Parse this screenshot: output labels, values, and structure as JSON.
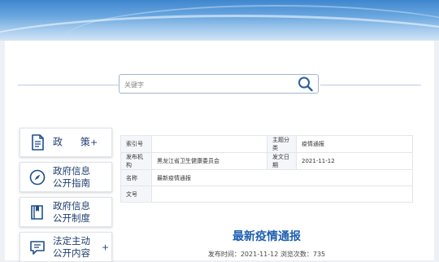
{
  "search": {
    "placeholder": "关键字"
  },
  "sidebar": {
    "items": [
      {
        "label": "政 策",
        "plus": "+"
      },
      {
        "line1": "政府信息",
        "line2": "公开指南"
      },
      {
        "line1": "政府信息",
        "line2": "公开制度"
      },
      {
        "line1": "法定主动",
        "line2": "公开内容",
        "plus": "+"
      }
    ]
  },
  "info_table": {
    "index_label": "索引号",
    "index_value": "",
    "category_label": "主题分类",
    "category_value": "疫情通报",
    "publisher_label": "发布机构",
    "publisher_value": "黑龙江省卫生健康委员会",
    "date_label": "发文日期",
    "date_value": "2021-11-12",
    "name_label": "名称",
    "name_value": "最新疫情通报",
    "docno_label": "文号",
    "docno_value": ""
  },
  "document": {
    "title": "最新疫情通报",
    "meta": "发布时间：2021-11-12    浏览次数：735"
  },
  "colors": {
    "accent": "#1f5fb0",
    "banner": "#3f86cf"
  }
}
